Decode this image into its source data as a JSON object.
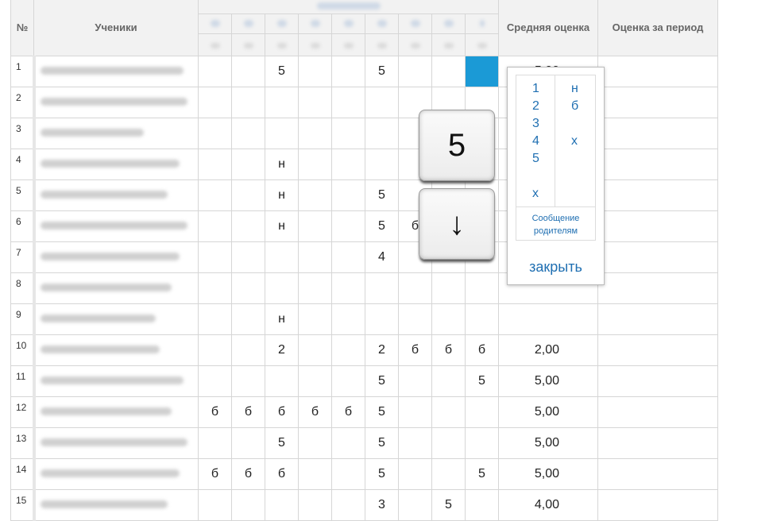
{
  "header": {
    "num": "№",
    "students": "Ученики",
    "avg": "Средняя оценка",
    "period": "Оценка за период"
  },
  "rows": [
    {
      "num": "1",
      "grades": [
        "",
        "",
        "5",
        "",
        "",
        "5",
        "",
        "",
        ""
      ],
      "avg": "5,00"
    },
    {
      "num": "2",
      "grades": [
        "",
        "",
        "",
        "",
        "",
        "",
        "",
        "",
        ""
      ],
      "avg": ""
    },
    {
      "num": "3",
      "grades": [
        "",
        "",
        "",
        "",
        "",
        "",
        "",
        "",
        ""
      ],
      "avg": ""
    },
    {
      "num": "4",
      "grades": [
        "",
        "",
        "н",
        "",
        "",
        "",
        "",
        "",
        ""
      ],
      "avg": ""
    },
    {
      "num": "5",
      "grades": [
        "",
        "",
        "н",
        "",
        "",
        "5",
        "",
        "",
        ""
      ],
      "avg": ""
    },
    {
      "num": "6",
      "grades": [
        "",
        "",
        "н",
        "",
        "",
        "5",
        "б",
        "",
        ""
      ],
      "avg": ""
    },
    {
      "num": "7",
      "grades": [
        "",
        "",
        "",
        "",
        "",
        "4",
        "",
        "",
        ""
      ],
      "avg": ""
    },
    {
      "num": "8",
      "grades": [
        "",
        "",
        "",
        "",
        "",
        "",
        "",
        "",
        ""
      ],
      "avg": ""
    },
    {
      "num": "9",
      "grades": [
        "",
        "",
        "н",
        "",
        "",
        "",
        "",
        "",
        ""
      ],
      "avg": ""
    },
    {
      "num": "10",
      "grades": [
        "",
        "",
        "2",
        "",
        "",
        "2",
        "б",
        "б",
        "б"
      ],
      "avg": "2,00"
    },
    {
      "num": "11",
      "grades": [
        "",
        "",
        "",
        "",
        "",
        "5",
        "",
        "",
        "5"
      ],
      "avg": "5,00"
    },
    {
      "num": "12",
      "grades": [
        "б",
        "б",
        "б",
        "б",
        "б",
        "5",
        "",
        "",
        ""
      ],
      "avg": "5,00"
    },
    {
      "num": "13",
      "grades": [
        "",
        "",
        "5",
        "",
        "",
        "5",
        "",
        "",
        ""
      ],
      "avg": "5,00"
    },
    {
      "num": "14",
      "grades": [
        "б",
        "б",
        "б",
        "",
        "",
        "5",
        "",
        "",
        "5"
      ],
      "avg": "5,00"
    },
    {
      "num": "15",
      "grades": [
        "",
        "",
        "",
        "",
        "",
        "3",
        "",
        "5",
        ""
      ],
      "avg": "4,00"
    }
  ],
  "keys": {
    "key1": "5",
    "key2": "↓"
  },
  "popup": {
    "grades": [
      "1",
      "2",
      "3",
      "4",
      "5",
      "х"
    ],
    "marks": [
      "н",
      "б",
      "х"
    ],
    "message": "Сообщение родителям",
    "close": "закрыть"
  },
  "colors": {
    "selected_cell": "#1b9ad6",
    "link": "#1f6fb2"
  }
}
